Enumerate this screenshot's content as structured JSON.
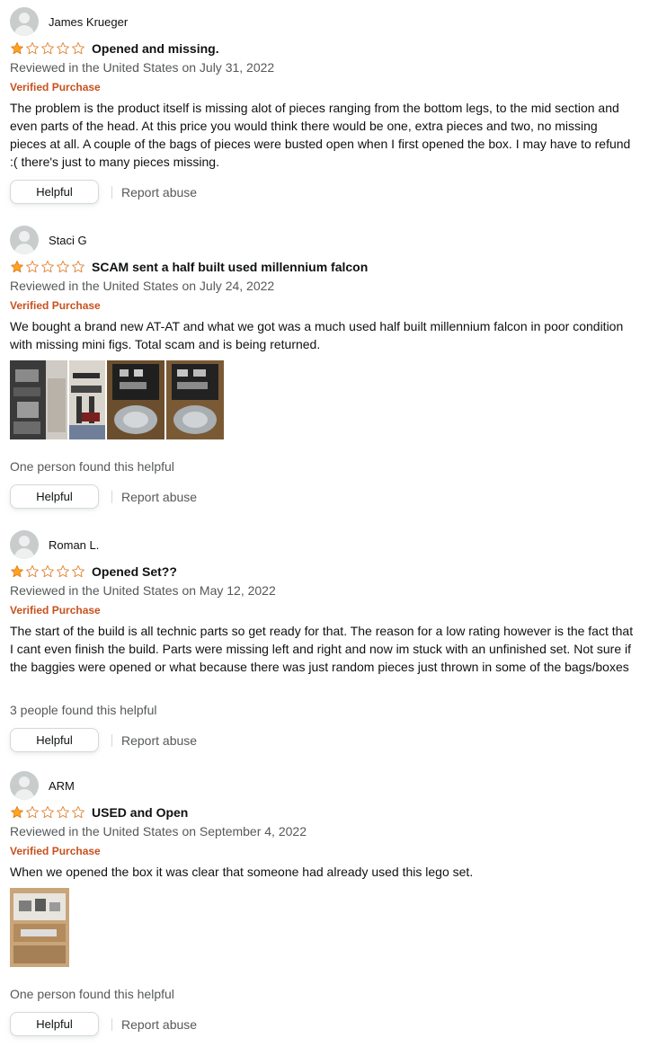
{
  "colors": {
    "star_fill": "#FFA41C",
    "star_outline": "#DE7921",
    "verified": "#C7511F",
    "secondary_text": "#565959"
  },
  "reviews": [
    {
      "profile_name": "James Krueger",
      "rating": 1,
      "title": "Opened and missing.",
      "date": "Reviewed in the United States on July 31, 2022",
      "verified": "Verified Purchase",
      "body": "The problem is the product itself is missing alot of pieces ranging from the bottom legs, to the mid section and even parts of the head. At this price you would think there would be one, extra pieces and two, no missing pieces at all. A couple of the bags of pieces were busted open when I first opened the box. I may have to refund :( there's just to many pieces missing.",
      "helpful_label": "Helpful",
      "report_label": "Report abuse"
    },
    {
      "profile_name": "Staci G",
      "rating": 1,
      "title": "SCAM sent a half built used millennium falcon",
      "date": "Reviewed in the United States on July 24, 2022",
      "verified": "Verified Purchase",
      "body": "We bought a brand new AT-AT and what we got was a much used half built millennium falcon in poor condition with missing mini figs. Total scam and is being returned.",
      "images": [
        "review-photo-1",
        "review-photo-2",
        "review-photo-3",
        "review-photo-4"
      ],
      "helpful_count": "One person found this helpful",
      "helpful_label": "Helpful",
      "report_label": "Report abuse"
    },
    {
      "profile_name": "Roman L.",
      "rating": 1,
      "title": "Opened Set??",
      "date": "Reviewed in the United States on May 12, 2022",
      "verified": "Verified Purchase",
      "body": "The start of the build is all technic parts so get ready for that. The reason for a low rating however is the fact that I cant even finish the build. Parts were missing left and right and now im stuck with an unfinished set. Not sure if the baggies were opened or what because there was just random pieces just thrown in some of the bags/boxes",
      "helpful_count": "3 people found this helpful",
      "helpful_label": "Helpful",
      "report_label": "Report abuse"
    },
    {
      "profile_name": "ARM",
      "rating": 1,
      "title": "USED and Open",
      "date": "Reviewed in the United States on September 4, 2022",
      "verified": "Verified Purchase",
      "body": "When we opened the box it was clear that someone had already used this lego set.",
      "images": [
        "review-photo-1"
      ],
      "helpful_count": "One person found this helpful",
      "helpful_label": "Helpful",
      "report_label": "Report abuse"
    }
  ]
}
